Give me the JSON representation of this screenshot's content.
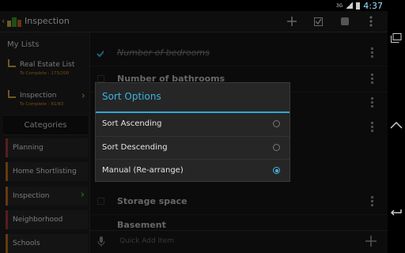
{
  "status_bar": {
    "network": "3G",
    "time": "4:37"
  },
  "action_bar": {
    "title": "Inspection",
    "actions": [
      "add-icon",
      "check-icon",
      "tag-icon",
      "overflow-icon"
    ]
  },
  "sidebar": {
    "header": "My Lists",
    "lists": [
      {
        "label": "Real Estate List",
        "sub": "To Complete : 173/200"
      },
      {
        "label": "Inspection",
        "sub": "To Complete : 81/83"
      }
    ],
    "categories_header": "Categories",
    "categories": [
      {
        "label": "Planning",
        "color": "#a33333"
      },
      {
        "label": "Home Shortlisting",
        "color": "#b86a1a"
      },
      {
        "label": "Inspection",
        "color": "#b86a1a"
      },
      {
        "label": "Neighborhood",
        "color": "#a33333"
      },
      {
        "label": "Schools",
        "color": "#b86a1a"
      }
    ]
  },
  "main": {
    "items": [
      {
        "label": "Number of bedrooms",
        "checked": true
      },
      {
        "label": "Number of bathrooms",
        "checked": false
      },
      {
        "label": "Storage space",
        "checked": false
      },
      {
        "label": "Basement",
        "checked": false
      }
    ],
    "quick_add_placeholder": "Quick Add Item"
  },
  "dialog": {
    "title": "Sort Options",
    "options": [
      {
        "label": "Sort Ascending",
        "selected": false
      },
      {
        "label": "Sort Descending",
        "selected": false
      },
      {
        "label": "Manual (Re-arrange)",
        "selected": true
      }
    ]
  },
  "colors": {
    "accent": "#33b5e5",
    "arrow": "#49b02a",
    "subtext": "#d88a1a"
  }
}
